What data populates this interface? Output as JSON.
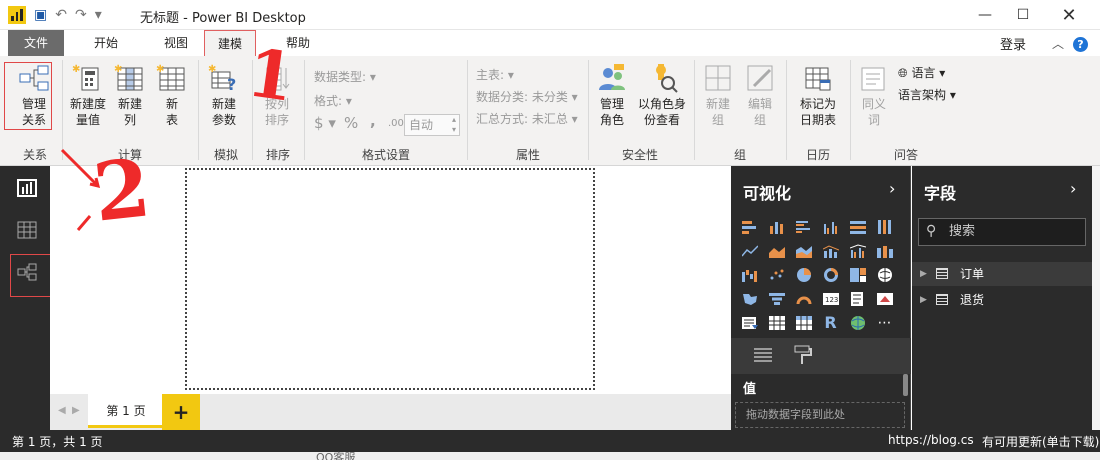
{
  "titlebar": {
    "title": "无标题 - Power BI Desktop"
  },
  "menu": {
    "file": "文件",
    "home": "开始",
    "view": "视图",
    "modeling": "建模",
    "help": "帮助",
    "login": "登录"
  },
  "ribbon": {
    "manage_relationships": "管理\n关系",
    "new_measure": "新建度\n量值",
    "new_column": "新建\n列",
    "new_table": "新\n表",
    "new_parameter": "新建\n参数",
    "sort_by_column": "按列\n排序",
    "data_type": "数据类型:",
    "format": "格式:",
    "currency": "$",
    "percent": "%",
    "comma": ",",
    "decimal": ".00",
    "auto": "自动",
    "home_table": "主表:",
    "data_category": "数据分类: 未分类",
    "summarization": "汇总方式: 未汇总",
    "manage_roles": "管理\n角色",
    "view_as_roles": "以角色身\n份查看",
    "new_group": "新建\n组",
    "edit_group": "编辑\n组",
    "mark_as_date_table": "标记为\n日期表",
    "synonyms": "同义\n词",
    "language": "语言",
    "linguistic_schema": "语言架构",
    "groups": {
      "relationships": "关系",
      "calculations": "计算",
      "whatif": "模拟",
      "sort": "排序",
      "formatting": "格式设置",
      "properties": "属性",
      "security": "安全性",
      "group": "组",
      "calendars": "日历",
      "qna": "问答"
    }
  },
  "pages": {
    "tab1": "第 1 页",
    "add": "+"
  },
  "status": {
    "page_info": "第 1 页，共 1 页",
    "update": "有可用更新(单击下载)",
    "watermark": "https://blog.cs"
  },
  "visualizations": {
    "title": "可视化",
    "values_label": "值",
    "drop_hint": "拖动数据字段到此处"
  },
  "fields": {
    "title": "字段",
    "search_placeholder": "搜索",
    "tables": [
      "订单",
      "退货"
    ]
  },
  "annotations": {
    "one": "1",
    "two": "2"
  },
  "below_text": "QQ客服"
}
